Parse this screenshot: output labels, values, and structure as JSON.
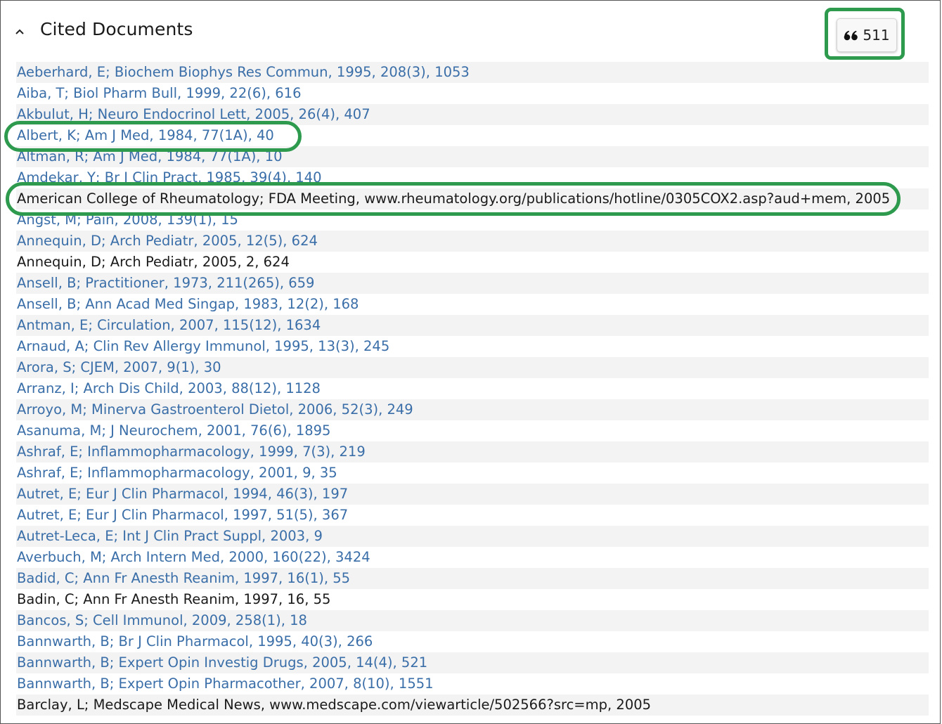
{
  "section": {
    "title": "Cited Documents",
    "toggle_icon": "chevron-up-icon",
    "cite_icon": "quote-icon",
    "cite_count": "511"
  },
  "colors": {
    "link": "#3a6ea8",
    "plain_text": "#1a1a1a",
    "highlight": "#2e9a4e",
    "stripe": "#f3f3f3"
  },
  "references": [
    {
      "text": "Aeberhard, E; Biochem Biophys Res Commun, 1995, 208(3), 1053",
      "link": true
    },
    {
      "text": "Aiba, T; Biol Pharm Bull, 1999, 22(6), 616",
      "link": true
    },
    {
      "text": "Akbulut, H; Neuro Endocrinol Lett, 2005, 26(4), 407",
      "link": true
    },
    {
      "text": "Albert, K; Am J Med, 1984, 77(1A), 40",
      "link": true,
      "highlighted": true
    },
    {
      "text": "Altman, R; Am J Med, 1984, 77(1A), 10",
      "link": true
    },
    {
      "text": "Amdekar, Y; Br J Clin Pract, 1985, 39(4), 140",
      "link": true
    },
    {
      "text": "American College of Rheumatology; FDA Meeting, www.rheumatology.org/publications/hotline/0305COX2.asp?aud+mem, 2005",
      "link": false,
      "highlighted": true
    },
    {
      "text": "Angst, M; Pain, 2008, 139(1), 15",
      "link": true
    },
    {
      "text": "Annequin, D; Arch Pediatr, 2005, 12(5), 624",
      "link": true
    },
    {
      "text": "Annequin, D; Arch Pediatr, 2005, 2, 624",
      "link": false
    },
    {
      "text": "Ansell, B; Practitioner, 1973, 211(265), 659",
      "link": true
    },
    {
      "text": "Ansell, B; Ann Acad Med Singap, 1983, 12(2), 168",
      "link": true
    },
    {
      "text": "Antman, E; Circulation, 2007, 115(12), 1634",
      "link": true
    },
    {
      "text": "Arnaud, A; Clin Rev Allergy Immunol, 1995, 13(3), 245",
      "link": true
    },
    {
      "text": "Arora, S; CJEM, 2007, 9(1), 30",
      "link": true
    },
    {
      "text": "Arranz, I; Arch Dis Child, 2003, 88(12), 1128",
      "link": true
    },
    {
      "text": "Arroyo, M; Minerva Gastroenterol Dietol, 2006, 52(3), 249",
      "link": true
    },
    {
      "text": "Asanuma, M; J Neurochem, 2001, 76(6), 1895",
      "link": true
    },
    {
      "text": "Ashraf, E; Inflammopharmacology, 1999, 7(3), 219",
      "link": true
    },
    {
      "text": "Ashraf, E; Inflammopharmacology, 2001, 9, 35",
      "link": true
    },
    {
      "text": "Autret, E; Eur J Clin Pharmacol, 1994, 46(3), 197",
      "link": true
    },
    {
      "text": "Autret, E; Eur J Clin Pharmacol, 1997, 51(5), 367",
      "link": true
    },
    {
      "text": "Autret-Leca, E; Int J Clin Pract Suppl, 2003, 9",
      "link": true
    },
    {
      "text": "Averbuch, M; Arch Intern Med, 2000, 160(22), 3424",
      "link": true
    },
    {
      "text": "Badid, C; Ann Fr Anesth Reanim, 1997, 16(1), 55",
      "link": true
    },
    {
      "text": "Badin, C; Ann Fr Anesth Reanim, 1997, 16, 55",
      "link": false
    },
    {
      "text": "Bancos, S; Cell Immunol, 2009, 258(1), 18",
      "link": true
    },
    {
      "text": "Bannwarth, B; Br J Clin Pharmacol, 1995, 40(3), 266",
      "link": true
    },
    {
      "text": "Bannwarth, B; Expert Opin Investig Drugs, 2005, 14(4), 521",
      "link": true
    },
    {
      "text": "Bannwarth, B; Expert Opin Pharmacother, 2007, 8(10), 1551",
      "link": true
    },
    {
      "text": "Barclay, L; Medscape Medical News, www.medscape.com/viewarticle/502566?src=mp, 2005",
      "link": false
    }
  ]
}
